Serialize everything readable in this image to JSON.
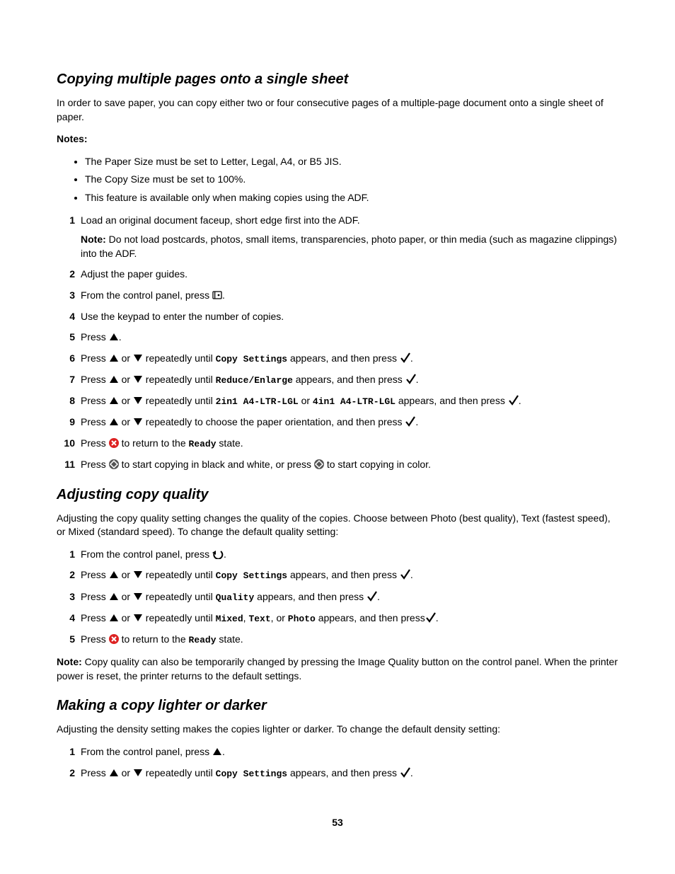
{
  "page_number": "53",
  "section1": {
    "heading": "Copying multiple pages onto a single sheet",
    "intro": "In order to save paper, you can copy either two or four consecutive pages of a multiple-page document onto a single sheet of paper.",
    "notes_label": "Notes:",
    "notes": [
      "The Paper Size must be set to Letter, Legal, A4, or B5 JIS.",
      "The Copy Size must be set to 100%.",
      "This feature is available only when making copies using the ADF."
    ],
    "step1_text": "Load an original document faceup, short edge first into the ADF.",
    "step1_note_label": "Note:",
    "step1_note": " Do not load postcards, photos, small items, transparencies, photo paper, or thin media (such as magazine clippings) into the ADF.",
    "step2_text": "Adjust the paper guides.",
    "step3_a": "From the control panel, press ",
    "step3_b": ".",
    "step4_text": "Use the keypad to enter the number of copies.",
    "step5_a": "Press ",
    "step5_b": ".",
    "step6_a": "Press ",
    "step6_b": " or ",
    "step6_c": " repeatedly until ",
    "step6_d": "Copy Settings",
    "step6_e": " appears, and then press ",
    "step6_f": ".",
    "step7_a": "Press ",
    "step7_b": " or ",
    "step7_c": " repeatedly until ",
    "step7_d": "Reduce/Enlarge",
    "step7_e": " appears, and then press ",
    "step7_f": ".",
    "step8_a": "Press ",
    "step8_b": " or ",
    "step8_c": " repeatedly until ",
    "step8_d": "2in1 A4-LTR-LGL",
    "step8_e": " or ",
    "step8_f": "4in1 A4-LTR-LGL",
    "step8_g": " appears, and then press ",
    "step8_h": ".",
    "step9_a": "Press ",
    "step9_b": " or ",
    "step9_c": " repeatedly to choose the paper orientation, and then press ",
    "step9_d": ".",
    "step10_a": "Press ",
    "step10_b": " to return to the ",
    "step10_c": "Ready",
    "step10_d": " state.",
    "step11_a": "Press ",
    "step11_b": " to start copying in black and white, or press ",
    "step11_c": " to start copying in color."
  },
  "section2": {
    "heading": "Adjusting copy quality",
    "intro": "Adjusting the copy quality setting changes the quality of the copies. Choose between Photo (best quality), Text (fastest speed), or Mixed (standard speed). To change the default quality setting:",
    "step1_a": "From the control panel, press ",
    "step1_b": ".",
    "step2_a": "Press ",
    "step2_b": " or ",
    "step2_c": " repeatedly until ",
    "step2_d": "Copy Settings",
    "step2_e": " appears, and then press ",
    "step2_f": ".",
    "step3_a": "Press ",
    "step3_b": " or ",
    "step3_c": " repeatedly until ",
    "step3_d": "Quality",
    "step3_e": " appears, and then press ",
    "step3_f": ".",
    "step4_a": "Press ",
    "step4_b": " or ",
    "step4_c": " repeatedly until ",
    "step4_d": "Mixed",
    "step4_e": ", ",
    "step4_f": "Text",
    "step4_g": ", or ",
    "step4_h": "Photo",
    "step4_i": " appears, and then press",
    "step4_j": ".",
    "step5_a": "Press ",
    "step5_b": " to return to the ",
    "step5_c": "Ready",
    "step5_d": " state.",
    "footnote_label": "Note:",
    "footnote": " Copy quality can also be temporarily changed by pressing the Image Quality button on the control panel. When the printer power is reset, the printer returns to the default settings."
  },
  "section3": {
    "heading": "Making a copy lighter or darker",
    "intro": "Adjusting the density setting makes the copies lighter or darker. To change the default density setting:",
    "step1_a": "From the control panel, press ",
    "step1_b": ".",
    "step2_a": "Press ",
    "step2_b": " or ",
    "step2_c": " repeatedly until ",
    "step2_d": "Copy Settings",
    "step2_e": " appears, and then press ",
    "step2_f": "."
  }
}
